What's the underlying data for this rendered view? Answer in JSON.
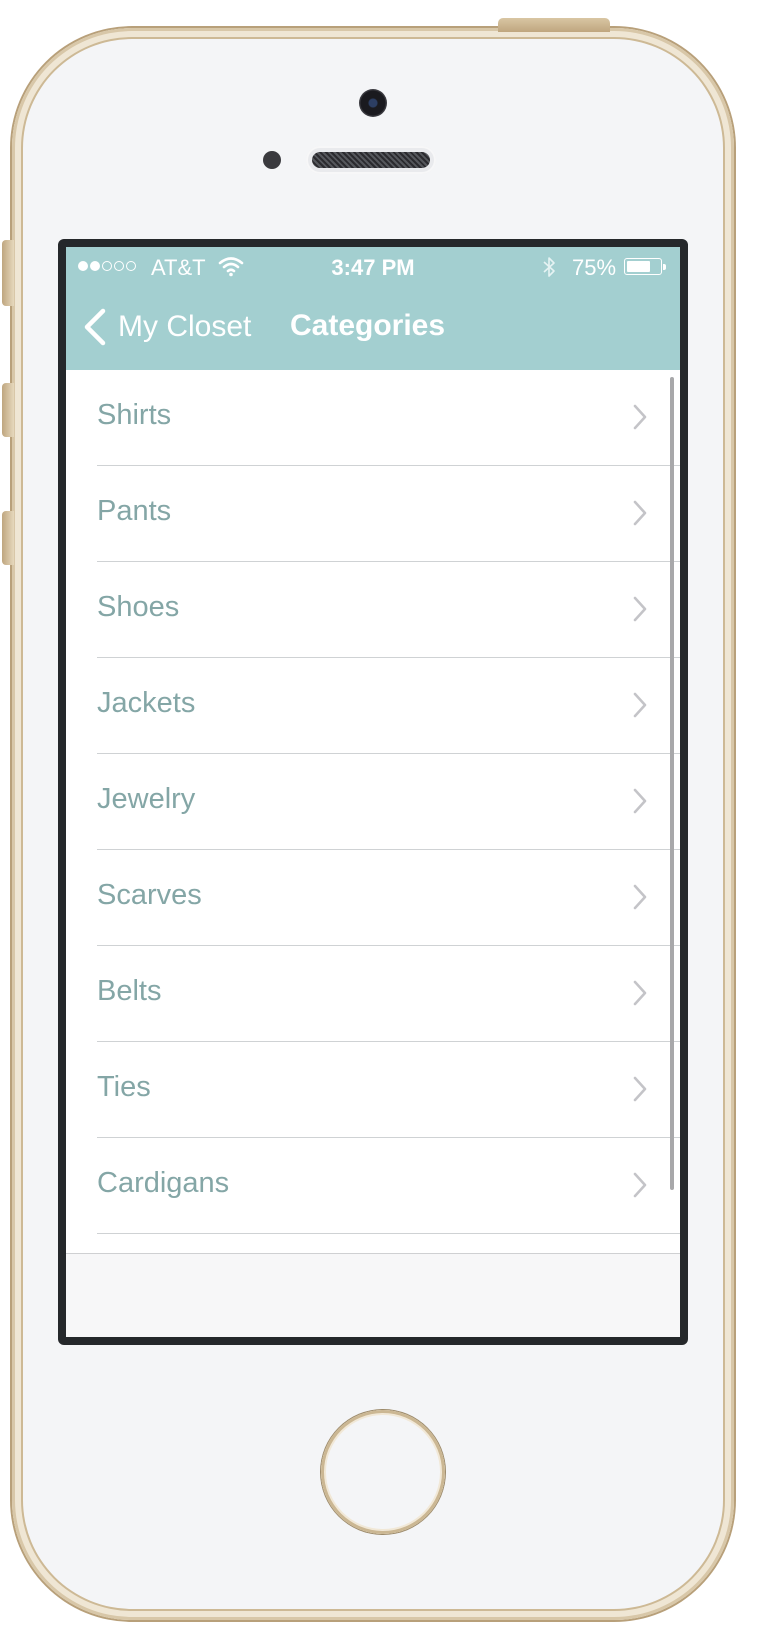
{
  "status_bar": {
    "signal_full": 2,
    "signal_total": 5,
    "carrier": "AT&T",
    "time": "3:47 PM",
    "battery_percent": "75%",
    "battery_level": 0.75
  },
  "navbar": {
    "back_label": "My Closet",
    "title": "Categories",
    "background": "#a3cfd0"
  },
  "categories": [
    {
      "label": "Shirts"
    },
    {
      "label": "Pants"
    },
    {
      "label": "Shoes"
    },
    {
      "label": "Jackets"
    },
    {
      "label": "Jewelry"
    },
    {
      "label": "Scarves"
    },
    {
      "label": "Belts"
    },
    {
      "label": "Ties"
    },
    {
      "label": "Cardigans"
    }
  ],
  "colors": {
    "row_text": "#84a6a6",
    "chevron": "#c4c4c8"
  }
}
